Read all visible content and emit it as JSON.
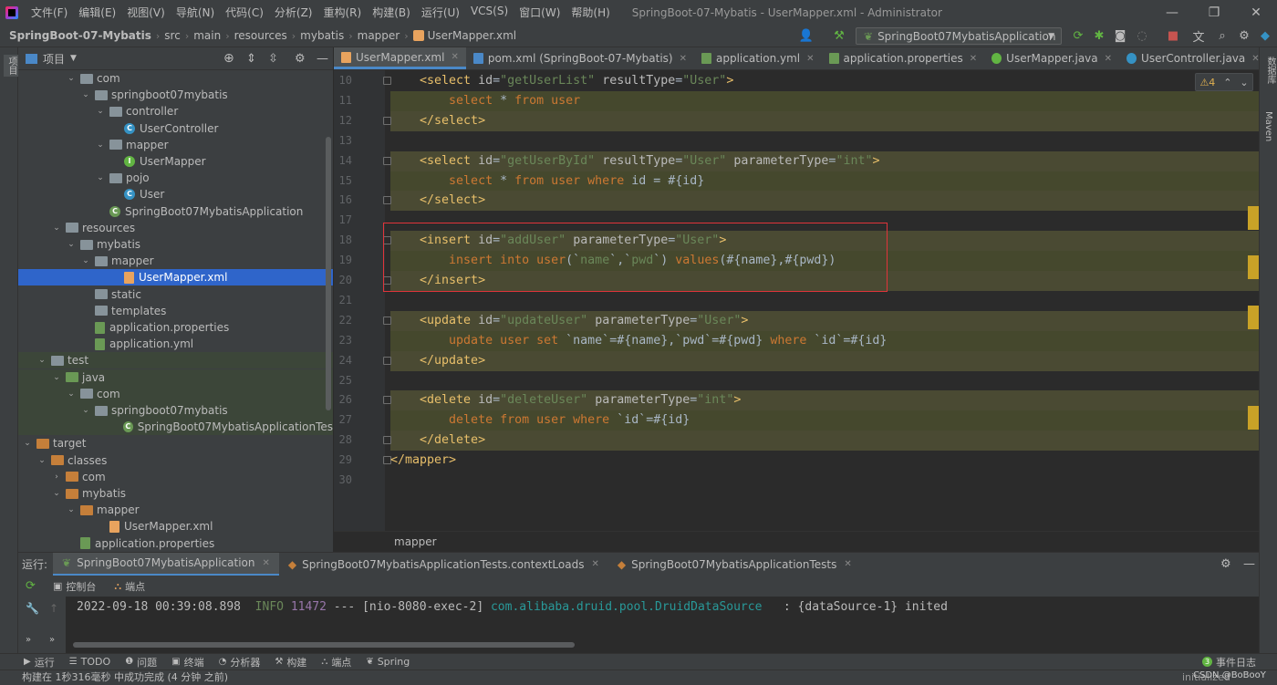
{
  "menubar": {
    "items": [
      "文件(F)",
      "编辑(E)",
      "视图(V)",
      "导航(N)",
      "代码(C)",
      "分析(Z)",
      "重构(R)",
      "构建(B)",
      "运行(U)",
      "VCS(S)",
      "窗口(W)",
      "帮助(H)"
    ],
    "title": "SpringBoot-07-Mybatis - UserMapper.xml - Administrator",
    "minimize": "—",
    "maximize": "❐",
    "close": "✕"
  },
  "breadcrumb": [
    "SpringBoot-07-Mybatis",
    "src",
    "main",
    "resources",
    "mybatis",
    "mapper",
    "UserMapper.xml"
  ],
  "toolbar": {
    "run_config": "SpringBoot07MybatisApplication"
  },
  "left_strip": {
    "project": "项目"
  },
  "right_strip": {
    "database": "数据库",
    "maven": "Maven"
  },
  "project": {
    "title": "项目",
    "tree": [
      {
        "label": "com",
        "kind": "folder",
        "depth": 4,
        "open": true
      },
      {
        "label": "springboot07mybatis",
        "kind": "folder",
        "depth": 5,
        "open": true
      },
      {
        "label": "controller",
        "kind": "folder",
        "depth": 6,
        "open": true
      },
      {
        "label": "UserController",
        "kind": "class",
        "depth": 7
      },
      {
        "label": "mapper",
        "kind": "folder",
        "depth": 6,
        "open": true
      },
      {
        "label": "UserMapper",
        "kind": "interface",
        "depth": 7
      },
      {
        "label": "pojo",
        "kind": "folder",
        "depth": 6,
        "open": true
      },
      {
        "label": "User",
        "kind": "class",
        "depth": 7
      },
      {
        "label": "SpringBoot07MybatisApplication",
        "kind": "spring",
        "depth": 6
      },
      {
        "label": "resources",
        "kind": "folder-res",
        "depth": 3,
        "open": true
      },
      {
        "label": "mybatis",
        "kind": "folder",
        "depth": 4,
        "open": true
      },
      {
        "label": "mapper",
        "kind": "folder",
        "depth": 5,
        "open": true
      },
      {
        "label": "UserMapper.xml",
        "kind": "xml",
        "depth": 7,
        "selected": true
      },
      {
        "label": "static",
        "kind": "folder",
        "depth": 5
      },
      {
        "label": "templates",
        "kind": "folder",
        "depth": 5
      },
      {
        "label": "application.properties",
        "kind": "leaf",
        "depth": 5
      },
      {
        "label": "application.yml",
        "kind": "leaf",
        "depth": 5
      },
      {
        "label": "test",
        "kind": "folder",
        "depth": 2,
        "open": true
      },
      {
        "label": "java",
        "kind": "folder-test",
        "depth": 3,
        "open": true
      },
      {
        "label": "com",
        "kind": "folder",
        "depth": 4,
        "open": true
      },
      {
        "label": "springboot07mybatis",
        "kind": "folder",
        "depth": 5,
        "open": true
      },
      {
        "label": "SpringBoot07MybatisApplicationTes",
        "kind": "spring",
        "depth": 7
      },
      {
        "label": "target",
        "kind": "folder-orange",
        "depth": 1,
        "open": true
      },
      {
        "label": "classes",
        "kind": "folder-orange",
        "depth": 2,
        "open": true
      },
      {
        "label": "com",
        "kind": "folder-orange",
        "depth": 3,
        "closed": true
      },
      {
        "label": "mybatis",
        "kind": "folder-orange",
        "depth": 3,
        "open": true
      },
      {
        "label": "mapper",
        "kind": "folder-orange",
        "depth": 4,
        "open": true
      },
      {
        "label": "UserMapper.xml",
        "kind": "xml",
        "depth": 6
      },
      {
        "label": "application.properties",
        "kind": "leaf",
        "depth": 4
      }
    ]
  },
  "tabs": [
    {
      "label": "UserMapper.xml",
      "icon": "xml",
      "active": true
    },
    {
      "label": "pom.xml (SpringBoot-07-Mybatis)",
      "icon": "maven"
    },
    {
      "label": "application.yml",
      "icon": "leaf"
    },
    {
      "label": "application.properties",
      "icon": "leaf"
    },
    {
      "label": "UserMapper.java",
      "icon": "interface"
    },
    {
      "label": "UserController.java",
      "icon": "class"
    }
  ],
  "inspections": {
    "warnings": "⚠4",
    "up": "⌃",
    "down": "⌄"
  },
  "editor": {
    "lines": [
      {
        "n": "10",
        "parts": [
          [
            "t",
            "    <select "
          ],
          [
            "a",
            "id"
          ],
          [
            "s",
            "="
          ],
          [
            "v",
            "\"getUserList\""
          ],
          [
            "s",
            " "
          ],
          [
            "a",
            "resultType"
          ],
          [
            "s",
            "="
          ],
          [
            "v",
            "\"User\""
          ],
          [
            "t",
            ">"
          ]
        ]
      },
      {
        "n": "11",
        "parts": [
          [
            "k",
            "        select "
          ],
          [
            "s",
            "* "
          ],
          [
            "k",
            "from "
          ],
          [
            "k",
            "user"
          ]
        ],
        "band": "sql"
      },
      {
        "n": "12",
        "parts": [
          [
            "t",
            "    </select>"
          ]
        ],
        "band": "tag"
      },
      {
        "n": "13",
        "parts": []
      },
      {
        "n": "14",
        "parts": [
          [
            "t",
            "    <select "
          ],
          [
            "a",
            "id"
          ],
          [
            "s",
            "="
          ],
          [
            "v",
            "\"getUserById\""
          ],
          [
            "s",
            " "
          ],
          [
            "a",
            "resultType"
          ],
          [
            "s",
            "="
          ],
          [
            "v",
            "\"User\""
          ],
          [
            "s",
            " "
          ],
          [
            "a",
            "parameterType"
          ],
          [
            "s",
            "="
          ],
          [
            "v",
            "\"int\""
          ],
          [
            "t",
            ">"
          ]
        ],
        "band": "tag"
      },
      {
        "n": "15",
        "parts": [
          [
            "k",
            "        select "
          ],
          [
            "s",
            "* "
          ],
          [
            "k",
            "from "
          ],
          [
            "k",
            "user "
          ],
          [
            "k",
            "where "
          ],
          [
            "s",
            "id = #{id}"
          ]
        ],
        "band": "sql"
      },
      {
        "n": "16",
        "parts": [
          [
            "t",
            "    </select>"
          ]
        ],
        "band": "tag"
      },
      {
        "n": "17",
        "parts": []
      },
      {
        "n": "18",
        "parts": [
          [
            "t",
            "    <insert "
          ],
          [
            "a",
            "id"
          ],
          [
            "s",
            "="
          ],
          [
            "v",
            "\"addUser\""
          ],
          [
            "s",
            " "
          ],
          [
            "a",
            "parameterType"
          ],
          [
            "s",
            "="
          ],
          [
            "v",
            "\"User\""
          ],
          [
            "t",
            ">"
          ]
        ],
        "band": "tag"
      },
      {
        "n": "19",
        "parts": [
          [
            "k",
            "        insert "
          ],
          [
            "k",
            "into "
          ],
          [
            "k",
            "user"
          ],
          [
            "s",
            "(`"
          ],
          [
            "v",
            "name"
          ],
          [
            "s",
            "`,`"
          ],
          [
            "v",
            "pwd"
          ],
          [
            "s",
            "`) "
          ],
          [
            "k",
            "values"
          ],
          [
            "s",
            "(#{name},#{pwd})"
          ]
        ],
        "band": "sql"
      },
      {
        "n": "20",
        "parts": [
          [
            "t",
            "    </insert>"
          ]
        ],
        "band": "tag"
      },
      {
        "n": "21",
        "parts": []
      },
      {
        "n": "22",
        "parts": [
          [
            "t",
            "    <update "
          ],
          [
            "a",
            "id"
          ],
          [
            "s",
            "="
          ],
          [
            "v",
            "\"updateUser\""
          ],
          [
            "s",
            " "
          ],
          [
            "a",
            "parameterType"
          ],
          [
            "s",
            "="
          ],
          [
            "v",
            "\"User\""
          ],
          [
            "t",
            ">"
          ]
        ],
        "band": "tag"
      },
      {
        "n": "23",
        "parts": [
          [
            "k",
            "        update "
          ],
          [
            "k",
            "user "
          ],
          [
            "k",
            "set "
          ],
          [
            "s",
            "`name`=#{name},`pwd`=#{pwd} "
          ],
          [
            "k",
            "where "
          ],
          [
            "s",
            "`id`=#{id}"
          ]
        ],
        "band": "sql"
      },
      {
        "n": "24",
        "parts": [
          [
            "t",
            "    </update>"
          ]
        ],
        "band": "tag"
      },
      {
        "n": "25",
        "parts": []
      },
      {
        "n": "26",
        "parts": [
          [
            "t",
            "    <delete "
          ],
          [
            "a",
            "id"
          ],
          [
            "s",
            "="
          ],
          [
            "v",
            "\"deleteUser\""
          ],
          [
            "s",
            " "
          ],
          [
            "a",
            "parameterType"
          ],
          [
            "s",
            "="
          ],
          [
            "v",
            "\"int\""
          ],
          [
            "t",
            ">"
          ]
        ],
        "band": "tag"
      },
      {
        "n": "27",
        "parts": [
          [
            "k",
            "        delete "
          ],
          [
            "k",
            "from "
          ],
          [
            "k",
            "user "
          ],
          [
            "k",
            "where "
          ],
          [
            "s",
            "`id`=#{id}"
          ]
        ],
        "band": "sql"
      },
      {
        "n": "28",
        "parts": [
          [
            "t",
            "    </delete>"
          ]
        ],
        "band": "tag"
      },
      {
        "n": "29",
        "parts": [
          [
            "t",
            "</mapper>"
          ]
        ]
      },
      {
        "n": "30",
        "parts": []
      }
    ],
    "breadcrumb": "mapper"
  },
  "run": {
    "label": "运行:",
    "tabs": [
      "SpringBoot07MybatisApplication",
      "SpringBoot07MybatisApplicationTests.contextLoads",
      "SpringBoot07MybatisApplicationTests"
    ],
    "console": "控制台",
    "endpoints": "端点",
    "log": {
      "time": "2022-09-18 00:39:08.898",
      "level": "INFO",
      "pid": "11472",
      "sep": " --- ",
      "thread": "[nio-8080-exec-2]",
      "logger": "com.alibaba.druid.pool.DruidDataSource",
      "msg": "   : {dataSource-1} inited"
    }
  },
  "toolwindows": [
    {
      "icon": "▶",
      "label": "运行"
    },
    {
      "icon": "☰",
      "label": "TODO"
    },
    {
      "icon": "❶",
      "label": "问题"
    },
    {
      "icon": "▣",
      "label": "终端"
    },
    {
      "icon": "◔",
      "label": "分析器"
    },
    {
      "icon": "⚒",
      "label": "构建"
    },
    {
      "icon": "⛬",
      "label": "端点"
    },
    {
      "icon": "❦",
      "label": "Spring"
    }
  ],
  "event_log": {
    "count": "3",
    "label": "事件日志"
  },
  "status": {
    "text": "构建在 1秒316毫秒 中成功完成 (4 分钟 之前)",
    "right": "initialized",
    "watermark": "CSDN @BoBooY"
  },
  "colors": {
    "accent": "#4a88c7",
    "selection": "#2f65ca",
    "highlight_box": "#e0343a",
    "marker": "#c9a227"
  }
}
